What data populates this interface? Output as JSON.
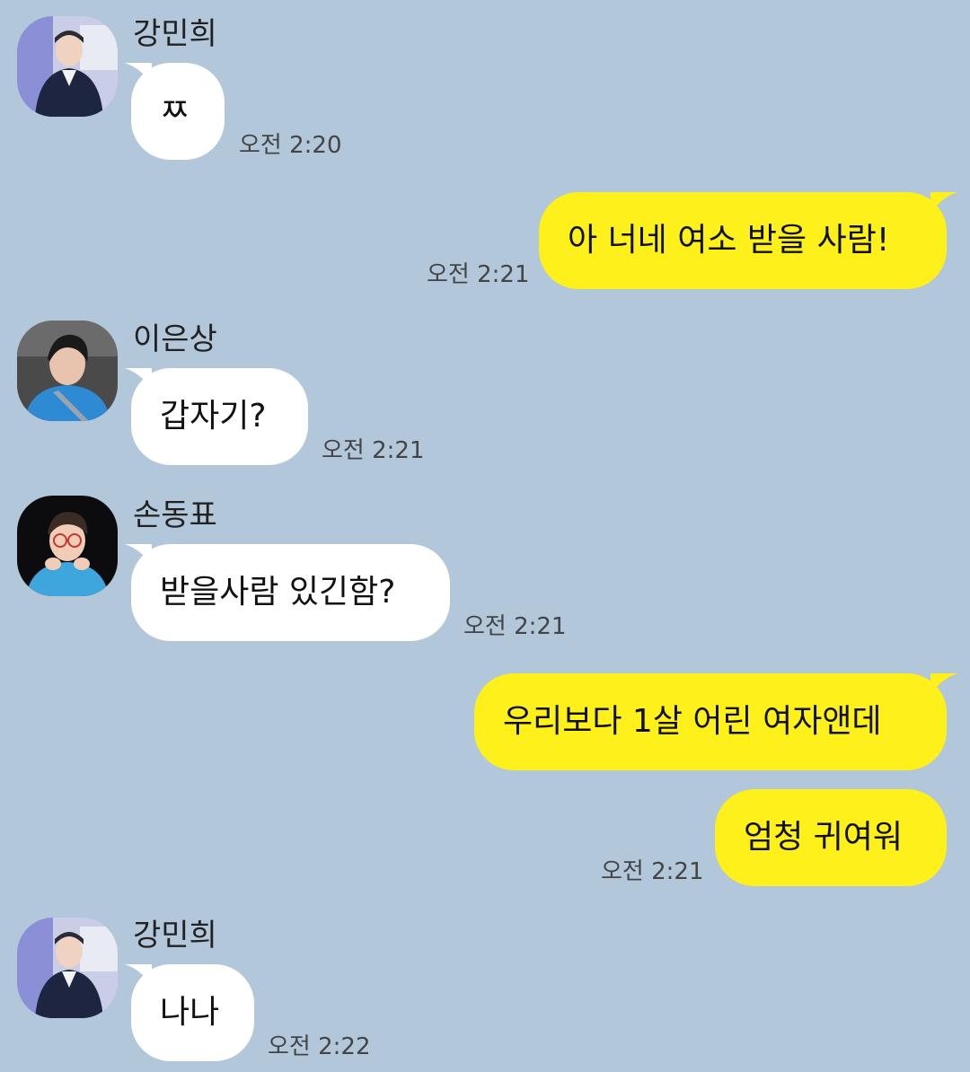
{
  "messages": [
    {
      "sender": "강민희",
      "text": "ㅉ",
      "time": "오전 2:20"
    },
    {
      "text": "아 너네 여소 받을 사람!",
      "time": "오전 2:21"
    },
    {
      "sender": "이은상",
      "text": "갑자기?",
      "time": "오전 2:21"
    },
    {
      "sender": "손동표",
      "text": "받을사람 있긴함?",
      "time": "오전 2:21"
    },
    {
      "text": "우리보다 1살 어린 여자앤데"
    },
    {
      "text": "엄청 귀여워",
      "time": "오전 2:21"
    },
    {
      "sender": "강민희",
      "text": "나나",
      "time": "오전 2:22"
    }
  ],
  "colors": {
    "background": "#b2c7da",
    "incoming_bubble": "#ffffff",
    "outgoing_bubble": "#fef01b"
  }
}
